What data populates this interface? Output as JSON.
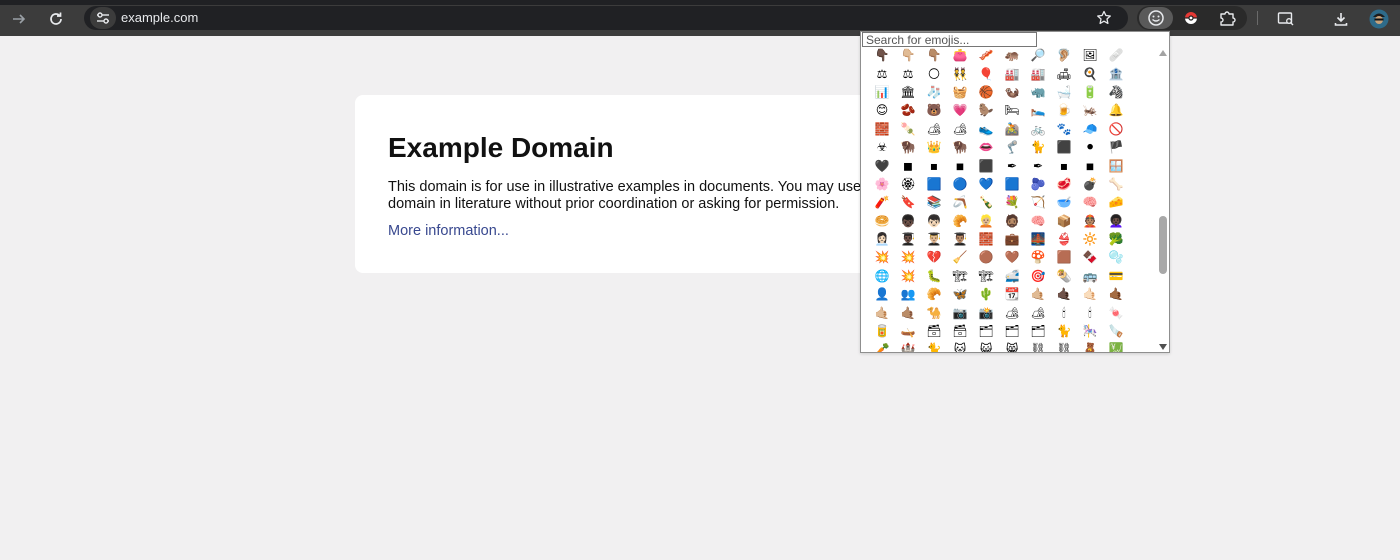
{
  "browser": {
    "url": "example.com",
    "icons": {
      "forward": "forward-arrow-icon",
      "reload": "reload-icon",
      "site_info": "tune-icon",
      "bookmark": "star-icon",
      "emoji_extension": "emoji-extension-icon",
      "pokeball_extension": "pokeball-icon",
      "extensions": "puzzle-icon",
      "cast": "cast-search-icon",
      "download": "download-icon",
      "profile": "avatar"
    }
  },
  "page": {
    "title": "Example Domain",
    "body": "This domain is for use in illustrative examples in documents. You may use this domain in literature without prior coordination or asking for permission.",
    "link": "More information..."
  },
  "emoji_picker": {
    "search_placeholder": "Search for emojis...",
    "emojis": "👇🏿👇🏼👇🏽👛🥓🦛🔎🦻🏼🖼🩹⚖⚖🌕👯🎈🏭🏭🛋🍳🏦📊🏛🧦🧺🏀🦦🦏🛁🔋🦓😊🫘🐻💗🦫🛏🛌🍺🦗🔔🧱🍡🏕🏕👟🚵🚲🐾🧢🚫☣🦬👑🦬👄🦿🐈⬛⚫🏴🖤◼▪◾⬛✒✒▪◾🪟🌸🏵🟦🔵💙🟦🫐🥩💣🦴🧨🔖📚🪃🍾💐🏹🥣🧠🧀🥯👦🏿👦🏻🥐👱🏼🧔🏽🧠📦👲🏽👩🏿‍🦱👩🏻‍💼👨🏿‍🎓👨🏼‍🎓👨🏽‍🎓🧱💼🌉👙🔆🥦💥💥💔🧹🟤🤎🍄🟫🍫🫧🌐💥🐛🏗🏗🚅🎯🌯🚌💳👤👥🥐🦋🌵📆🤙🏼🤙🏿🤙🏻🤙🏾🤙🏼🤙🏽🐪📷📸🏕🏕🕯🕯🍬🥫🛶🗃🗃🗂🗂🗂🐈🎠🪚🥕🏰🐈🐱😺😸⛓⛓🧸💹📈💹"
  }
}
